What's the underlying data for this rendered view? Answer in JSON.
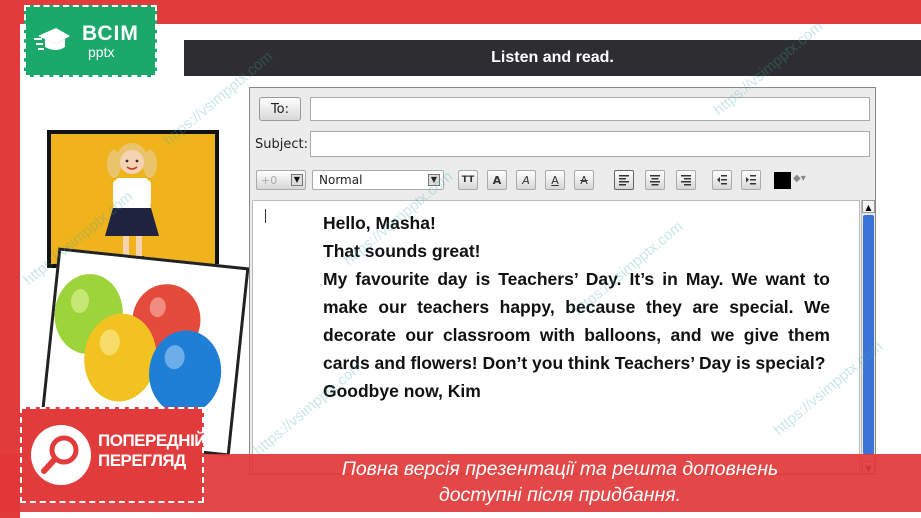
{
  "header": {
    "title": "Listen and read."
  },
  "logo": {
    "main": "ВСІМ",
    "sub": "pptx"
  },
  "email": {
    "to_label": "To:",
    "to_value": "",
    "subject_label": "Subject:",
    "subject_value": "",
    "toolbar": {
      "size_value": "+0",
      "style_value": "Normal",
      "color": "#000000"
    },
    "body": {
      "greeting": "Hello, Masha!",
      "line2": "That sounds great!",
      "paragraph": "My favourite day is Teachers’ Day. It’s in May. We want to make our teachers happy, because they are special. We decorate our classroom with balloons, and we give them cards and flowers! Don’t you think Teachers’ Day is special?",
      "signoff": "Goodbye now, Kim"
    }
  },
  "preview": {
    "line1": "ПОПЕРЕДНІЙ",
    "line2": "ПЕРЕГЛЯД"
  },
  "footer": {
    "line1": "Повна версія презентації та решта доповнень",
    "line2": "доступні після придбання."
  },
  "watermark": {
    "text": "https://vsimpptx.com"
  },
  "colors": {
    "accent_red": "#e23b3b",
    "logo_green": "#1aa86b",
    "header_dark": "#2e2e32",
    "photo_yellow": "#f0b31c",
    "scroll_blue": "#3a74d8"
  }
}
